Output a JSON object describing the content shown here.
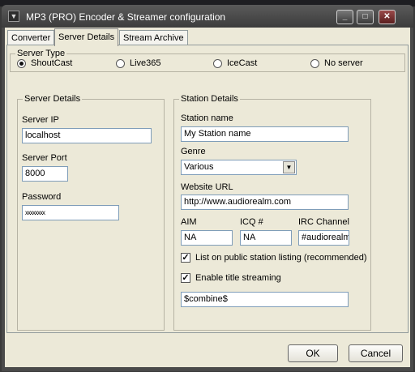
{
  "window": {
    "title": "MP3 (PRO) Encoder & Streamer configuration"
  },
  "tabs": [
    {
      "label": "Converter"
    },
    {
      "label": "Server Details"
    },
    {
      "label": "Stream Archive"
    }
  ],
  "active_tab": "Server Details",
  "server_type": {
    "legend": "Server Type",
    "options": [
      "ShoutCast",
      "Live365",
      "IceCast",
      "No server"
    ],
    "selected": "ShoutCast"
  },
  "server_details": {
    "legend": "Server Details",
    "ip_label": "Server IP",
    "ip_value": "localhost",
    "port_label": "Server Port",
    "port_value": "8000",
    "password_label": "Password",
    "password_value": "xxxxxxxx"
  },
  "station_details": {
    "legend": "Station Details",
    "name_label": "Station name",
    "name_value": "My Station name",
    "genre_label": "Genre",
    "genre_value": "Various",
    "url_label": "Website URL",
    "url_value": "http://www.audiorealm.com",
    "aim_label": "AIM",
    "aim_value": "NA",
    "icq_label": "ICQ #",
    "icq_value": "NA",
    "irc_label": "IRC Channel",
    "irc_value": "#audiorealm",
    "list_public_label": "List on public station listing (recommended)",
    "list_public_checked": true,
    "title_streaming_label": "Enable title streaming",
    "title_streaming_checked": true,
    "title_format_value": "$combine$"
  },
  "buttons": {
    "ok": "OK",
    "cancel": "Cancel"
  }
}
